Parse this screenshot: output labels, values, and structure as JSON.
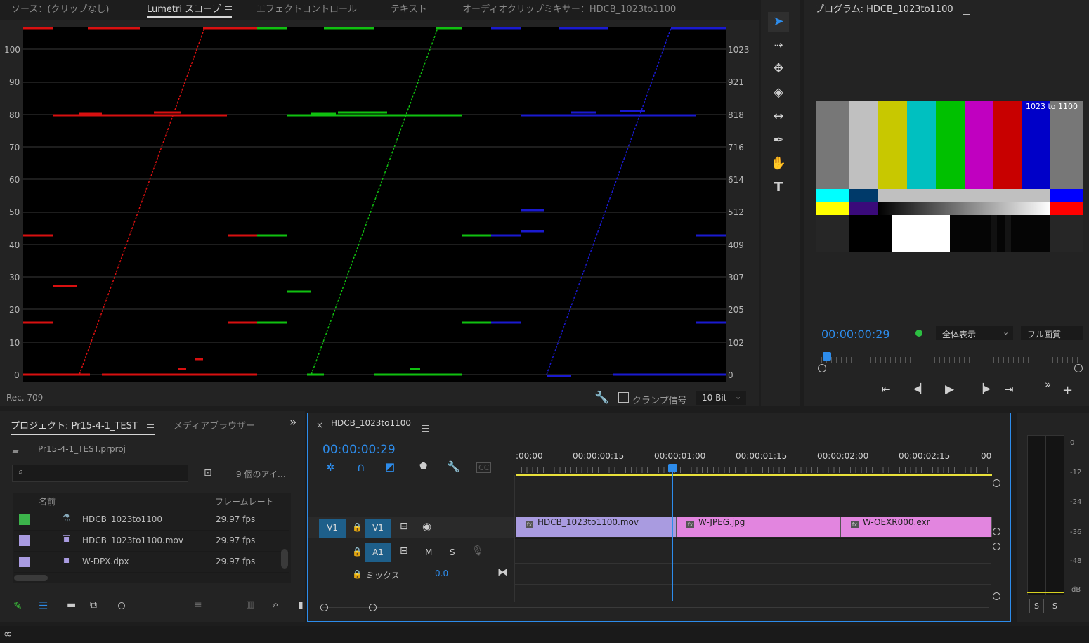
{
  "top_tabs": {
    "source": "ソース：(クリップなし)",
    "lumetri": "Lumetri スコープ",
    "effect_controls": "エフェクトコントロール",
    "text": "テキスト",
    "audio_mixer": "オーディオクリップミキサー：HDCB_1023to1100"
  },
  "scope": {
    "left_axis": [
      "100",
      "90",
      "80",
      "70",
      "60",
      "50",
      "40",
      "30",
      "20",
      "10",
      "0"
    ],
    "right_axis": [
      "1023",
      "921",
      "818",
      "716",
      "614",
      "512",
      "409",
      "307",
      "205",
      "102",
      "0"
    ],
    "colorspace": "Rec. 709",
    "clamp_label": "クランプ信号",
    "bit_depth": "10 Bit"
  },
  "program": {
    "title": "プログラム: HDCB_1023to1100",
    "overlay_text": "1023 to 1100",
    "timecode": "00:00:00:29",
    "fit": "全体表示",
    "quality": "フル画質"
  },
  "project": {
    "tab_project": "プロジェクト: Pr15-4-1_TEST",
    "tab_media": "メディアブラウザー",
    "file": "Pr15-4-1_TEST.prproj",
    "items_count": "9 個のアイ…",
    "col_name": "名前",
    "col_fps": "フレームレート",
    "rows": [
      {
        "name": "HDCB_1023to1100",
        "fps": "29.97 fps",
        "color": "#3cb44b",
        "icon": "sequence-icon"
      },
      {
        "name": "HDCB_1023to1100.mov",
        "fps": "29.97 fps",
        "color": "#a99be0",
        "icon": "film-icon"
      },
      {
        "name": "W-DPX.dpx",
        "fps": "29.97 fps",
        "color": "#a99be0",
        "icon": "film-icon"
      }
    ]
  },
  "timeline": {
    "tab": "HDCB_1023to1100",
    "timecode": "00:00:00:29",
    "ruler": [
      ":00:00",
      "00:00:00:15",
      "00:00:01:00",
      "00:00:01:15",
      "00:00:02:00",
      "00:00:02:15",
      "00"
    ],
    "v1_src": "V1",
    "v1": "V1",
    "a1": "A1",
    "m": "M",
    "s": "S",
    "mix_label": "ミックス",
    "mix_value": "0.0",
    "clips": [
      {
        "name": "HDCB_1023to1100.mov",
        "color": "#a99be0"
      },
      {
        "name": "W-JPEG.jpg",
        "color": "#e285df"
      },
      {
        "name": "W-OEXR000.exr",
        "color": "#e285df"
      }
    ]
  },
  "meter": {
    "labels": [
      "0",
      "-12",
      "-24",
      "-36",
      "-48",
      "dB"
    ],
    "solo_left": "S",
    "solo_right": "S"
  },
  "colors": {
    "accent": "#2d8ceb",
    "red": "#e01010",
    "green": "#10c010",
    "blue": "#1a1ad0"
  }
}
